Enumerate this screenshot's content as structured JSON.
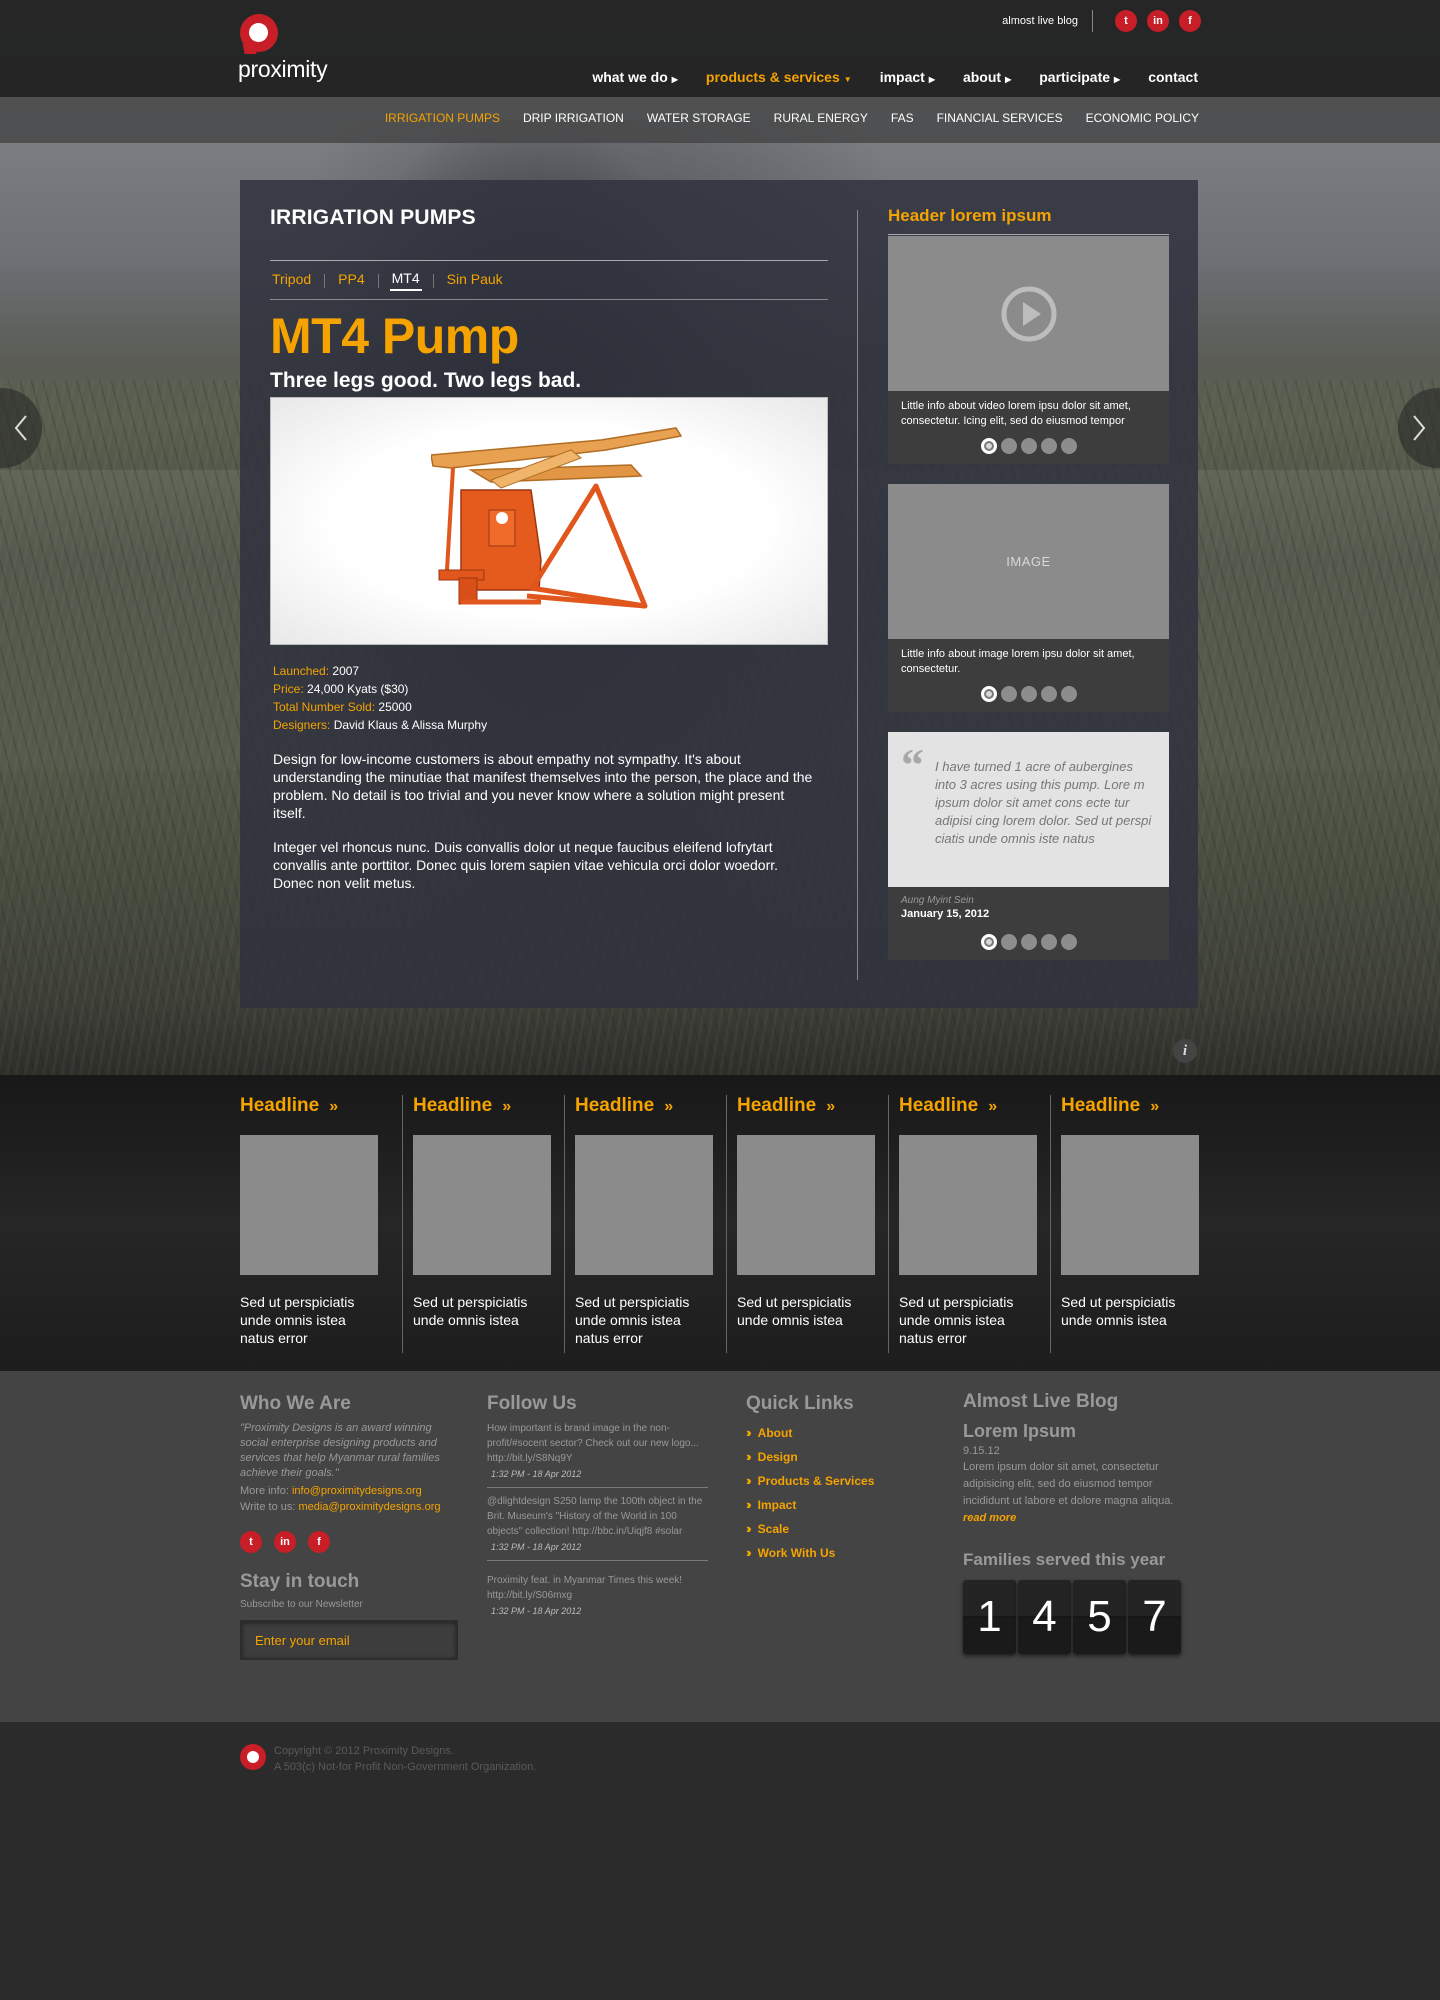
{
  "header": {
    "logo_text": "proximity",
    "blog_link": "almost live blog",
    "social": [
      "twitter-icon",
      "linkedin-icon",
      "facebook-icon"
    ],
    "nav": [
      {
        "label": "what we do",
        "active": false
      },
      {
        "label": "products & services",
        "active": true
      },
      {
        "label": "impact",
        "active": false
      },
      {
        "label": "about",
        "active": false
      },
      {
        "label": "participate",
        "active": false
      },
      {
        "label": "contact",
        "active": false
      }
    ],
    "subnav": [
      "IRRIGATION PUMPS",
      "DRIP IRRIGATION",
      "WATER STORAGE",
      "RURAL ENERGY",
      "FAS",
      "FINANCIAL SERVICES",
      "ECONOMIC POLICY"
    ],
    "subnav_active": "IRRIGATION PUMPS"
  },
  "colors": {
    "accent": "#f5a300",
    "brand_red": "#c81e27",
    "panel": "#30323e"
  },
  "main": {
    "section_title": "IRRIGATION PUMPS",
    "tabs": [
      "Tripod",
      "PP4",
      "MT4",
      "Sin Pauk"
    ],
    "active_tab": "MT4",
    "product_title": "MT4 Pump",
    "tagline": "Three legs good. Two legs bad.",
    "specs": [
      {
        "label": "Launched:",
        "value": "2007"
      },
      {
        "label": "Price:",
        "value": "24,000 Kyats ($30)"
      },
      {
        "label": "Total Number Sold:",
        "value": "25000"
      },
      {
        "label": "Designers:",
        "value": "David Klaus & Alissa Murphy"
      }
    ],
    "description_1": "Design for low-income customers is about empathy not sympathy. It's about understanding the minutiae that manifest themselves into the person, the place and the problem. No detail is too trivial and you never know where a solution might present itself.",
    "description_2": "Integer vel rhoncus nunc. Duis convallis dolor ut neque faucibus eleifend lofrytart convallis ante porttitor. Donec quis lorem sapien vitae vehicula orci dolor woedorr. Donec non velit metus."
  },
  "sidebar": {
    "header": "Header lorem ipsum",
    "video_caption": "Little info about video lorem ipsu dolor sit amet, consectetur. Icing elit, sed do eiusmod tempor",
    "image_label": "IMAGE",
    "image_caption": "Little info about image lorem ipsu dolor sit amet, consectetur.",
    "quote_text": "I have turned 1 acre of aubergines into 3 acres using this pump. Lore m ipsum dolor sit amet cons ecte tur adipisi cing lorem dolor. Sed ut perspi ciatis unde omnis iste natus",
    "quote_author": "Aung Myint Sein",
    "quote_date": "January 15, 2012"
  },
  "headlines": [
    {
      "title": "Headline",
      "text": "Sed ut perspiciatis unde omnis istea natus error"
    },
    {
      "title": "Headline",
      "text": "Sed ut perspiciatis unde omnis istea"
    },
    {
      "title": "Headline",
      "text": "Sed ut perspiciatis unde omnis istea natus error"
    },
    {
      "title": "Headline",
      "text": "Sed ut perspiciatis unde omnis istea"
    },
    {
      "title": "Headline",
      "text": "Sed ut perspiciatis unde omnis istea natus error"
    },
    {
      "title": "Headline",
      "text": "Sed ut perspiciatis unde omnis istea"
    }
  ],
  "footer": {
    "who": {
      "title": "Who We Are",
      "text": "\"Proximity Designs is an award winning social enterprise designing products and services that help Myanmar rural families achieve their goals.\"",
      "more_label": "More info:",
      "more_email": "info@proximitydesigns.org",
      "write_label": "Write to us:",
      "write_email": "media@proximitydesigns.org"
    },
    "stay": {
      "title": "Stay in touch",
      "subtitle": "Subscribe to our Newsletter",
      "placeholder": "Enter your email"
    },
    "follow": {
      "title": "Follow Us",
      "tweets": [
        {
          "text": "How important is brand image in the non-profit/#socent sector? Check out our new logo... http://bit.ly/S8Nq9Y",
          "time": "1:32 PM - 18 Apr 2012"
        },
        {
          "text": "@dlightdesign S250 lamp the 100th object in the Brit. Museum's \"History of the World in 100 objects\" collection! http://bbc.in/Uiqjf8 #solar",
          "time": "1:32 PM - 18 Apr 2012"
        },
        {
          "text": "Proximity feat. in Myanmar Times this week! http://bit.ly/S06mxg",
          "time": "1:32 PM - 18 Apr 2012"
        }
      ]
    },
    "quick_links": {
      "title": "Quick Links",
      "items": [
        "About",
        "Design",
        "Products & Services",
        "Impact",
        "Scale",
        "Work With Us"
      ]
    },
    "blog": {
      "title": "Almost Live Blog",
      "post_title": "Lorem Ipsum",
      "post_date": "9.15.12",
      "post_text": "Lorem ipsum dolor sit amet, consectetur adipisicing elit, sed do eiusmod tempor incididunt ut labore et dolore magna aliqua.",
      "read_more": "read more"
    },
    "families": {
      "title": "Families served this year",
      "digits": [
        "1",
        "4",
        "5",
        "7"
      ]
    },
    "copyright_1": "Copyright © 2012 Proximity Designs.",
    "copyright_2": "A 503(c) Not-for Profit Non-Government Organization."
  }
}
